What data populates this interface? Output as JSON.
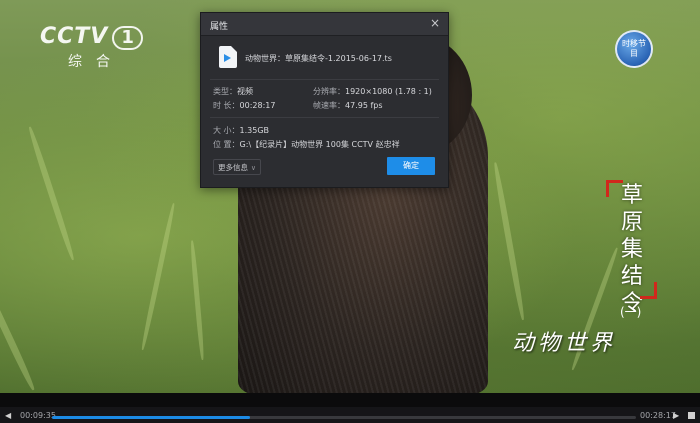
{
  "video": {
    "channel_logo": "CCTV",
    "channel_number": "1",
    "channel_subtitle": "综合",
    "corner_badge": "时移节目",
    "episode_title": [
      "草",
      "原",
      "集",
      "结",
      "令"
    ],
    "episode_part": "(一)",
    "show_title": "动物世界"
  },
  "dialog": {
    "title": "属性",
    "close_symbol": "×",
    "file_name": "动物世界：草原集结令-1.2015-06-17.ts",
    "type_label": "类型：",
    "type_value": "视频",
    "duration_label": "时 长：",
    "duration_value": "00:28:17",
    "resolution_label": "分辨率：",
    "resolution_value": "1920×1080 (1.78 : 1)",
    "framerate_label": "帧速率：",
    "framerate_value": "47.95 fps",
    "size_label": "大 小：",
    "size_value": "1.35GB",
    "location_label": "位 置：",
    "location_value": "G:\\【纪录片】动物世界 100集 CCTV 赵忠祥",
    "more_info": "更多信息",
    "more_caret": "∨",
    "ok": "确定"
  },
  "player": {
    "current_time": "00:09:35",
    "total_time": "00:28:17",
    "progress": 0.339,
    "prev_symbol": "◀",
    "next_symbol": "▶"
  },
  "colors": {
    "accent": "#1e8de8",
    "dialog_bg": "#2c2d31",
    "title_bracket": "#d0281c"
  }
}
